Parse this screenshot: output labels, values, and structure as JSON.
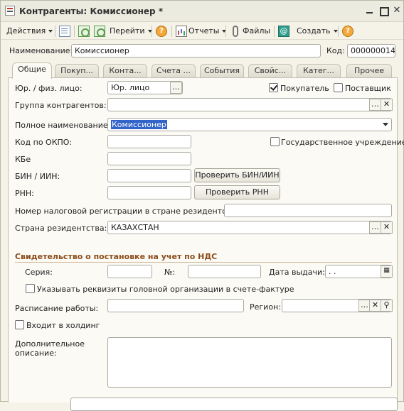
{
  "window": {
    "title": "Контрагенты: Комиссионер *"
  },
  "toolbar": {
    "actions": "Действия",
    "goto": "Перейти",
    "reports": "Отчеты",
    "files": "Файлы",
    "create": "Создать"
  },
  "header": {
    "name_label": "Наименование:",
    "name_value": "Комиссионер",
    "code_label": "Код:",
    "code_value": "000000014"
  },
  "tabs": [
    {
      "label": "Общие"
    },
    {
      "label": "Покуп..."
    },
    {
      "label": "Конта..."
    },
    {
      "label": "Счета ..."
    },
    {
      "label": "События"
    },
    {
      "label": "Свойс..."
    },
    {
      "label": "Катег..."
    },
    {
      "label": "Прочее"
    }
  ],
  "form": {
    "entity_type_label": "Юр. / физ. лицо:",
    "entity_type_value": "Юр. лицо",
    "buyer_label": "Покупатель",
    "buyer_checked": true,
    "supplier_label": "Поставщик",
    "supplier_checked": false,
    "group_label": "Группа контрагентов:",
    "group_value": "",
    "full_name_label": "Полное наименование:",
    "full_name_value": "Комиссионер",
    "okpo_label": "Код по ОКПО:",
    "okpo_value": "",
    "gov_label": "Государственное учреждение",
    "gov_checked": false,
    "kbe_label": "КБе",
    "kbe_value": "",
    "bin_label": "БИН / ИИН:",
    "bin_value": "",
    "check_bin_button": "Проверить БИН/ИИН",
    "rnn_label": "РНН:",
    "rnn_value": "",
    "check_rnn_button": "Проверить РНН",
    "tax_reg_label": "Номер налоговой регистрации в стране резидентства:",
    "tax_reg_value": "",
    "country_label": "Страна резидентства:",
    "country_value": "КАЗАХСТАН"
  },
  "vat": {
    "section_title": "Свидетельство о постановке на учет по НДС",
    "series_label": "Серия:",
    "series_value": "",
    "number_label": "№:",
    "number_value": "",
    "issue_date_label": "Дата выдачи:",
    "issue_date_value": " .  .",
    "head_org_label": "Указывать реквизиты головной организации в счете-фактуре",
    "head_org_checked": false
  },
  "extra": {
    "schedule_label": "Расписание работы:",
    "schedule_value": "",
    "region_label": "Регион:",
    "region_value": "",
    "holding_label": "Входит в холдинг",
    "holding_checked": false,
    "description_label_1": "Дополнительное",
    "description_label_2": "описание:",
    "description_value": ""
  }
}
